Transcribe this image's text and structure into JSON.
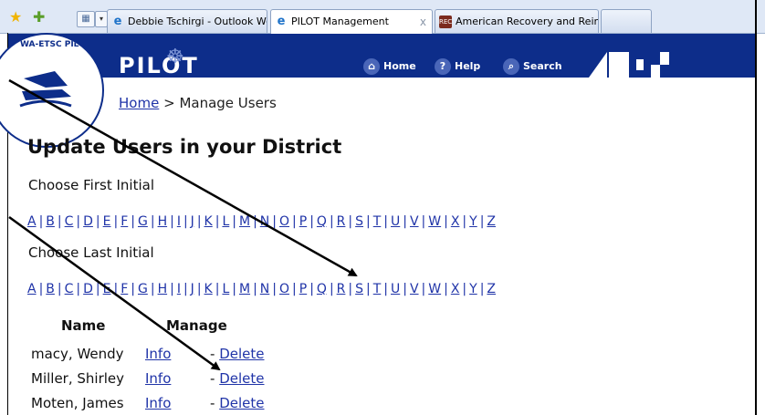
{
  "browser": {
    "tabs": [
      {
        "label": "Debbie Tschirgi - Outlook We...",
        "icon": "ie-icon",
        "active": false
      },
      {
        "label": "PILOT Management",
        "icon": "ie-icon",
        "active": true
      },
      {
        "label": "American Recovery and Rein...",
        "icon": "recovery-icon",
        "active": false
      }
    ],
    "close_glyph": "x"
  },
  "header": {
    "title": "PILOT",
    "logo_text": "WA-ETSC PILOT",
    "nav": [
      {
        "label": "Home",
        "icon": "home-icon"
      },
      {
        "label": "Help",
        "icon": "help-icon"
      },
      {
        "label": "Search",
        "icon": "search-icon"
      }
    ],
    "banner_color": "#0d2d8a"
  },
  "breadcrumb": {
    "home": "Home",
    "separator": ">",
    "current": "Manage Users"
  },
  "page": {
    "heading": "Update Users in your District",
    "first_label": "Choose First Initial",
    "last_label": "Choose Last Initial"
  },
  "letters": [
    "A",
    "B",
    "C",
    "D",
    "E",
    "F",
    "G",
    "H",
    "I",
    "J",
    "K",
    "L",
    "M",
    "N",
    "O",
    "P",
    "Q",
    "R",
    "S",
    "T",
    "U",
    "V",
    "W",
    "X",
    "Y",
    "Z"
  ],
  "table": {
    "headers": {
      "name": "Name",
      "manage": "Manage"
    },
    "rows": [
      {
        "name": "macy, Wendy",
        "info": "Info",
        "dash": "-",
        "delete": "Delete"
      },
      {
        "name": "Miller, Shirley",
        "info": "Info",
        "dash": "-",
        "delete": "Delete"
      },
      {
        "name": "Moten, James",
        "info": "Info",
        "dash": "-",
        "delete": "Delete"
      }
    ]
  },
  "colors": {
    "link": "#2034a8",
    "arrow": "#000000"
  }
}
